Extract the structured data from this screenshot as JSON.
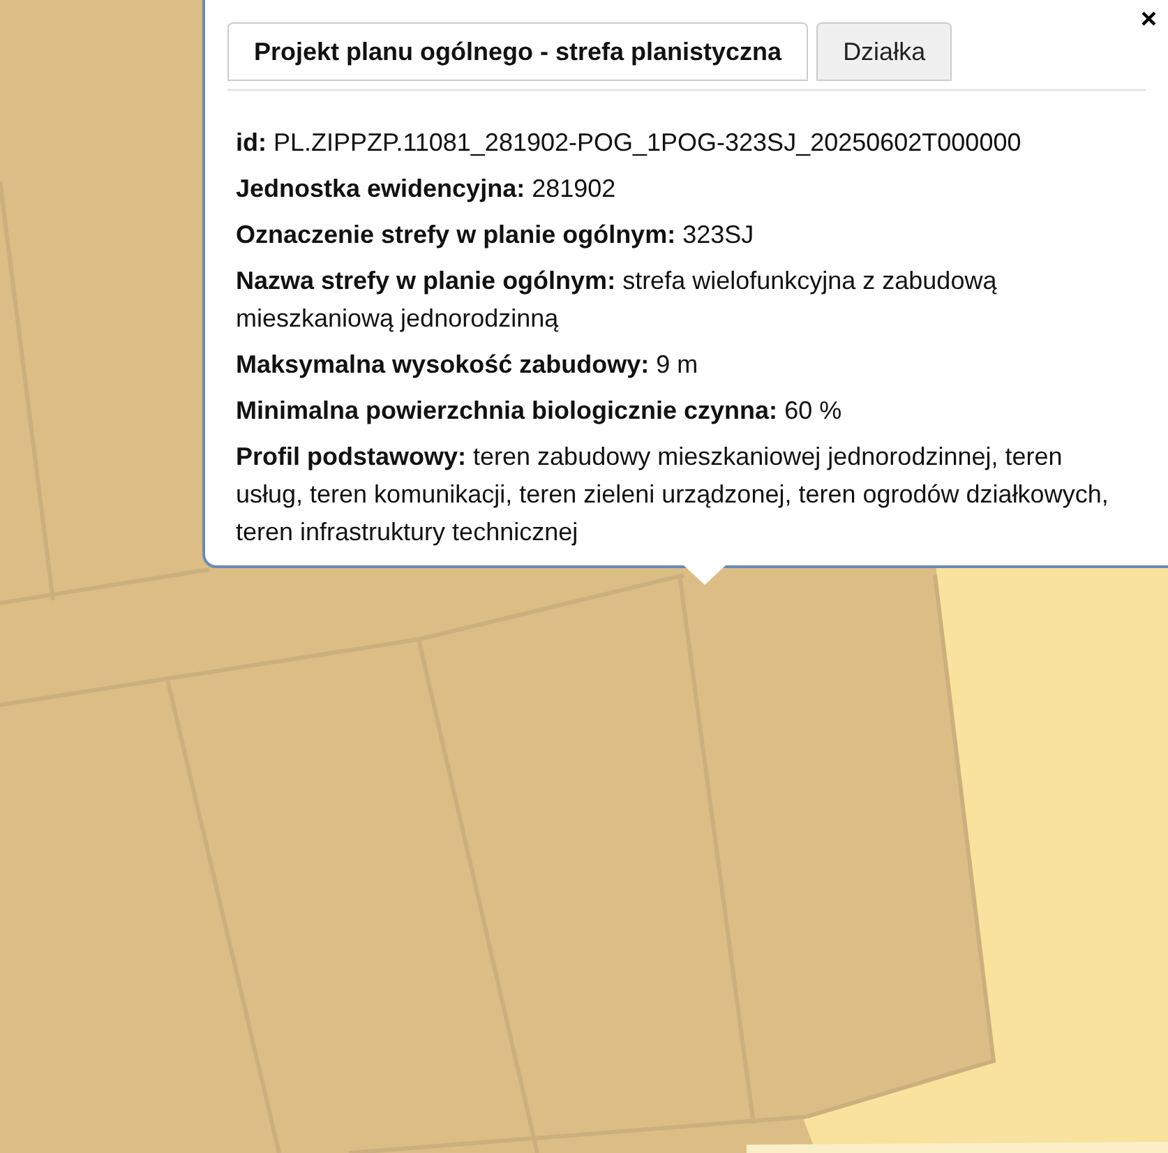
{
  "popup": {
    "close": "×",
    "tabs": [
      {
        "label": "Projekt planu ogólnego - strefa planistyczna",
        "selected": true
      },
      {
        "label": "Działka",
        "selected": false
      }
    ],
    "fields": [
      {
        "label": "id:",
        "value": "PL.ZIPPZP.11081_281902-POG_1POG-323SJ_20250602T000000"
      },
      {
        "label": "Jednostka ewidencyjna:",
        "value": "281902"
      },
      {
        "label": "Oznaczenie strefy w planie ogólnym:",
        "value": "323SJ"
      },
      {
        "label": "Nazwa strefy w planie ogólnym:",
        "value": "strefa wielofunkcyjna z zabudową mieszkaniową jednorodzinną"
      },
      {
        "label": "Maksymalna wysokość zabudowy:",
        "value": "9 m"
      },
      {
        "label": "Minimalna powierzchnia biologicznie czynna:",
        "value": "60 %"
      },
      {
        "label": "Profil podstawowy:",
        "value": "teren zabudowy mieszkaniowej jednorodzinnej, teren usług, teren komunikacji, teren zieleni urządzonej, teren ogrodów działkowych, teren infrastruktury technicznej"
      }
    ]
  }
}
